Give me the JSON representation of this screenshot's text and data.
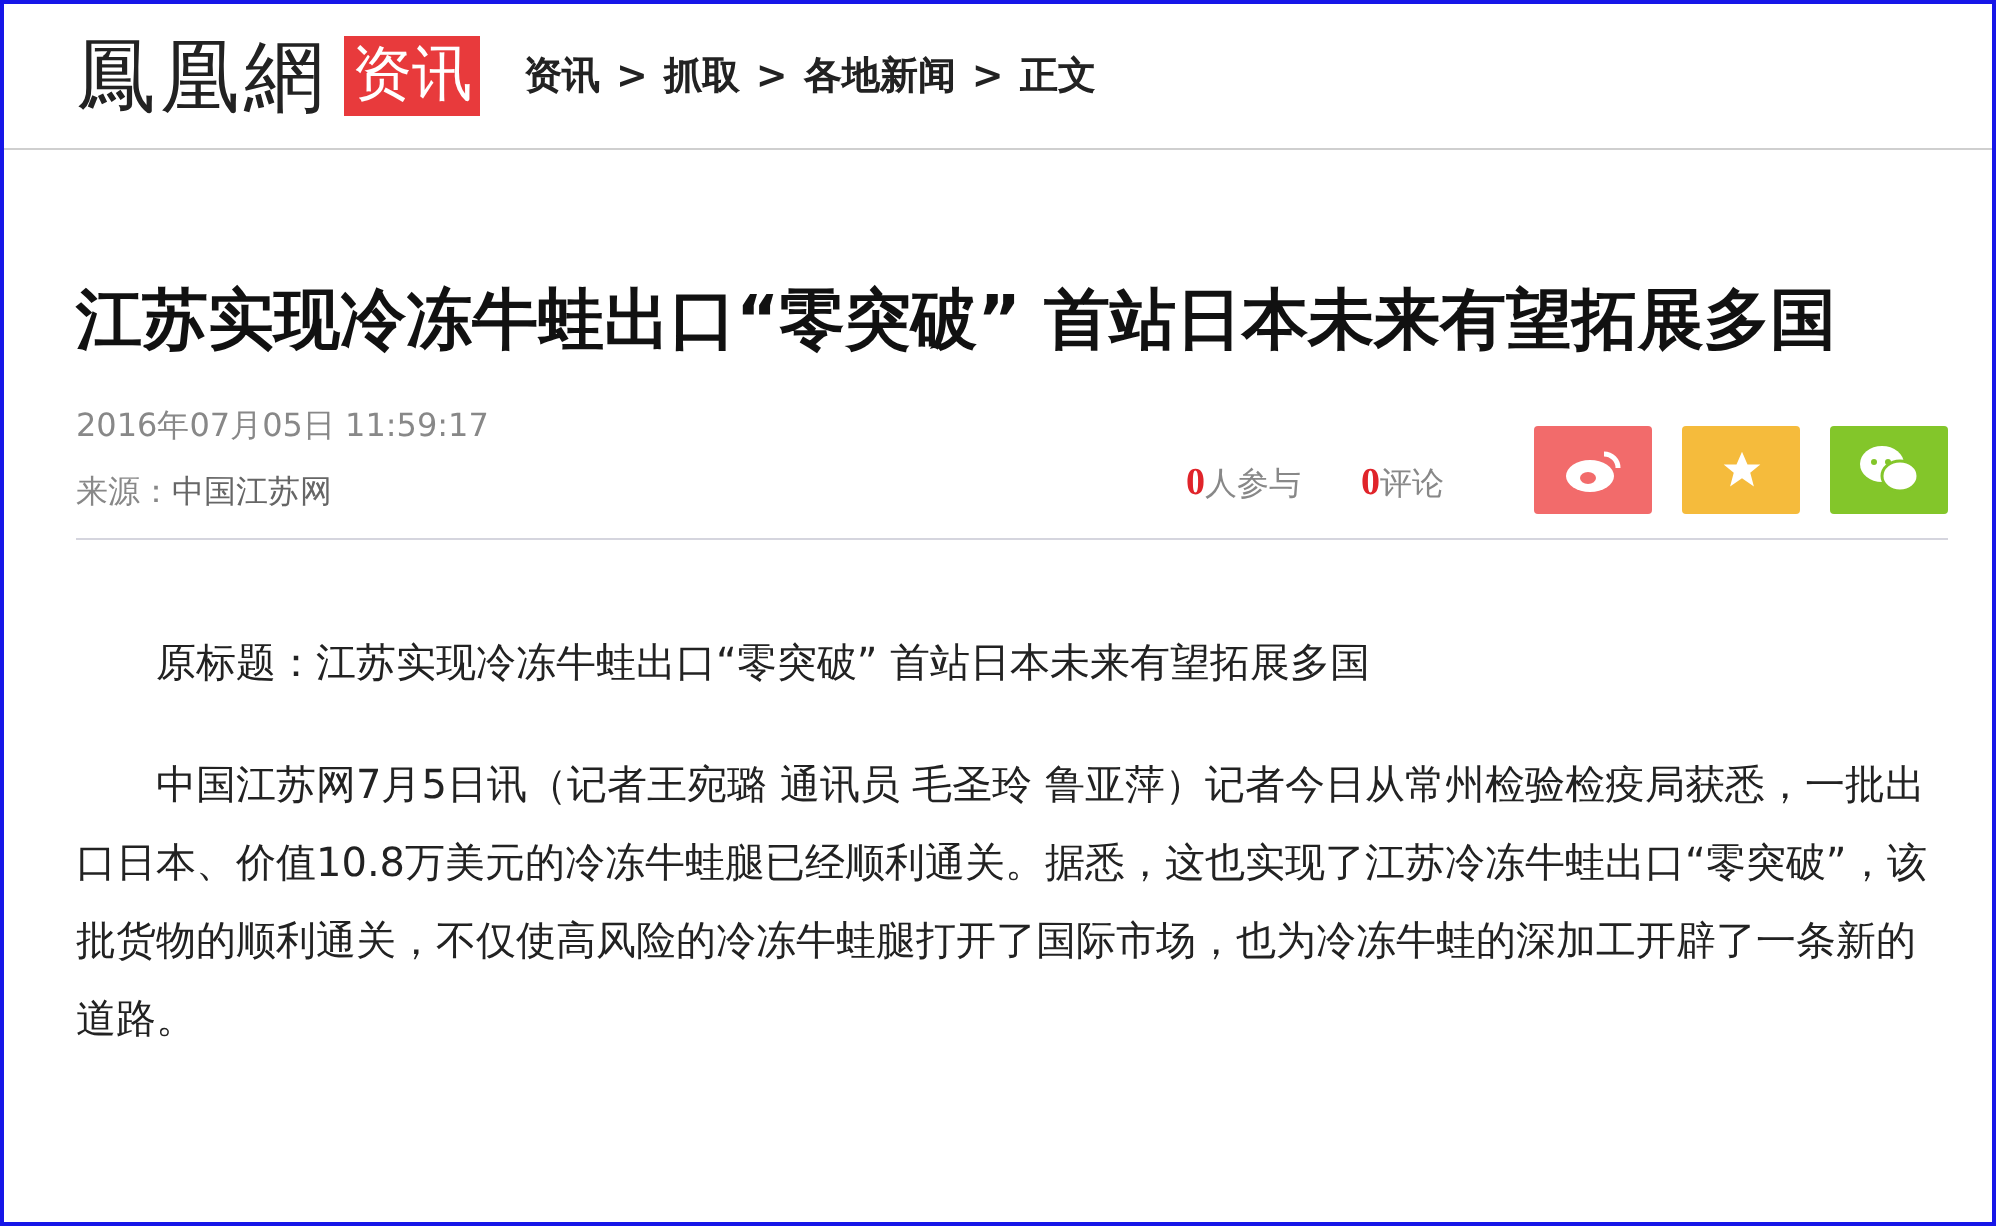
{
  "header": {
    "logo": "鳳凰網",
    "section_badge": "资讯",
    "breadcrumb": [
      {
        "label": "资讯"
      },
      {
        "separator": ">",
        "label": "抓取"
      },
      {
        "separator": ">",
        "label": "各地新闻"
      },
      {
        "separator": ">",
        "label": "正文"
      }
    ]
  },
  "article": {
    "title": "江苏实现冷冻牛蛙出口“零突破” 首站日本未来有望拓展多国",
    "timestamp": "2016年07月05日 11:59:17",
    "source_label": "来源：",
    "source": "中国江苏网",
    "stats": [
      {
        "count": "0",
        "label": "人参与"
      },
      {
        "count": "0",
        "label": "评论"
      }
    ],
    "share_buttons": [
      {
        "kind": "weibo",
        "color": "#f26b6b"
      },
      {
        "kind": "favorite",
        "color": "#f5bb3c"
      },
      {
        "kind": "wechat",
        "color": "#83c62a"
      }
    ],
    "paragraphs": [
      "原标题：江苏实现冷冻牛蛙出口“零突破” 首站日本未来有望拓展多国",
      "中国江苏网7月5日讯（记者王宛璐 通讯员 毛圣玲 鲁亚萍）记者今日从常州检验检疫局获悉，一批出口日本、价值10.8万美元的冷冻牛蛙腿已经顺利通关。据悉，这也实现了江苏冷冻牛蛙出口“零突破”，该批货物的顺利通关，不仅使高风险的冷冻牛蛙腿打开了国际市场，也为冷冻牛蛙的深加工开辟了一条新的道路。"
    ]
  }
}
